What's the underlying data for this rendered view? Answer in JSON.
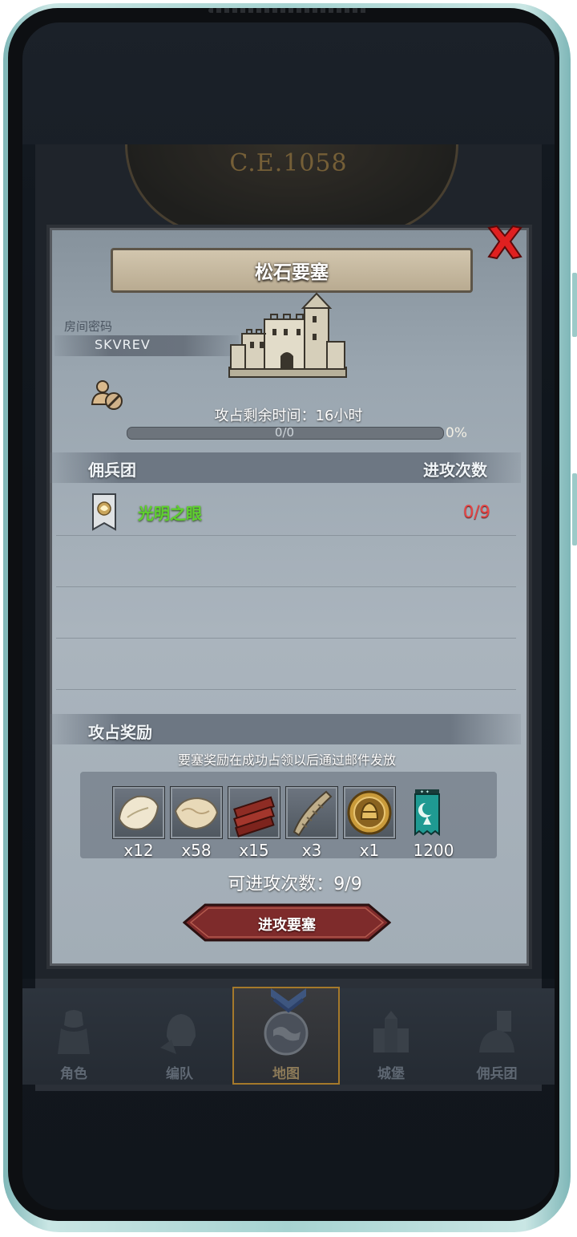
{
  "background": {
    "era_label": "C.E.1058"
  },
  "dialog": {
    "title": "松石要塞",
    "room_code_label": "房间密码",
    "room_code": "SKVREV",
    "occupy_time": "攻占剩余时间：16小时",
    "progress": {
      "text": "0/0",
      "percent": "0%",
      "fraction": 0
    },
    "mercenary_header": "佣兵团",
    "attacks_header": "进攻次数",
    "mercenaries": [
      {
        "name": "光明之眼",
        "attacks": "0/9"
      }
    ],
    "reward_header": "攻占奖励",
    "reward_note": "要塞奖励在成功占领以后通过邮件发放",
    "rewards": [
      {
        "icon": "fur-pelt-icon",
        "qty": "x12"
      },
      {
        "icon": "wool-hide-icon",
        "qty": "x58"
      },
      {
        "icon": "timber-icon",
        "qty": "x15"
      },
      {
        "icon": "horn-icon",
        "qty": "x3"
      },
      {
        "icon": "gold-helmet-medal-icon",
        "qty": "x1"
      },
      {
        "icon": "guild-banner-icon",
        "qty": "1200"
      }
    ],
    "remaining_attacks": "可进攻次数：9/9",
    "attack_button": "进攻要塞"
  },
  "nav": {
    "items": [
      {
        "label": "角色",
        "icon": "knight-icon",
        "active": false
      },
      {
        "label": "编队",
        "icon": "helmet-icon",
        "active": false
      },
      {
        "label": "地图",
        "icon": "globe-map-icon",
        "active": true
      },
      {
        "label": "城堡",
        "icon": "castle-nav-icon",
        "active": false
      },
      {
        "label": "佣兵团",
        "icon": "mercenary-icon",
        "active": false
      }
    ]
  },
  "colors": {
    "mercenary_name": "#5fd02f",
    "attacks_value": "#e84444",
    "close_red": "#e02020",
    "attack_button": "#7e2b2b"
  }
}
